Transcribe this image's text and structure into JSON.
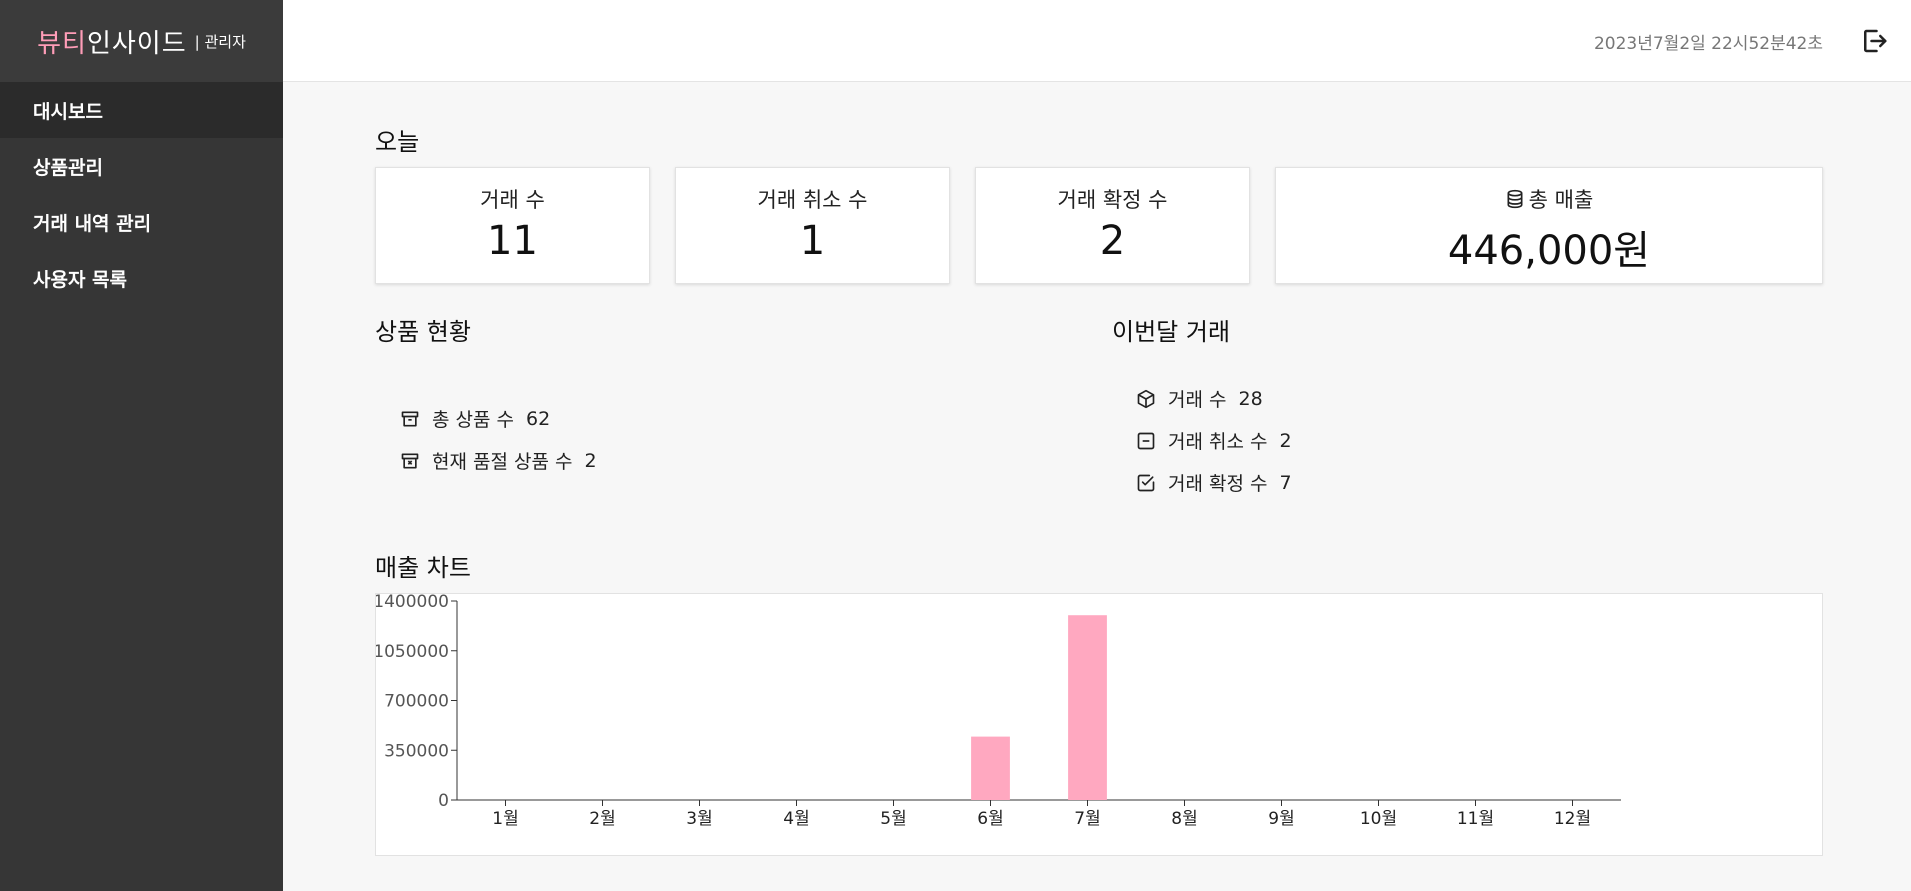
{
  "brand": {
    "logo_part1": "뷰티",
    "logo_part2": "인사이드",
    "role": "| 관리자"
  },
  "sidebar": {
    "items": [
      {
        "label": "대시보드",
        "active": true
      },
      {
        "label": "상품관리",
        "active": false
      },
      {
        "label": "거래 내역 관리",
        "active": false
      },
      {
        "label": "사용자 목록",
        "active": false
      }
    ]
  },
  "header": {
    "datetime": "2023년7월2일 22시52분42초",
    "logout_icon": "logout-icon"
  },
  "today": {
    "title": "오늘",
    "cards": [
      {
        "label": "거래 수",
        "value": "11"
      },
      {
        "label": "거래 취소 수",
        "value": "1"
      },
      {
        "label": "거래 확정 수",
        "value": "2"
      },
      {
        "label": "총 매출",
        "value": "446,000원",
        "icon": "coins-icon"
      }
    ]
  },
  "product_status": {
    "title": "상품 현황",
    "items": [
      {
        "label": "총 상품 수",
        "value": "62",
        "icon": "archive-icon"
      },
      {
        "label": "현재 품절 상품 수",
        "value": "2",
        "icon": "archive-x-icon"
      }
    ]
  },
  "month_trades": {
    "title": "이번달 거래",
    "items": [
      {
        "label": "거래 수",
        "value": "28",
        "icon": "cube-icon"
      },
      {
        "label": "거래 취소 수",
        "value": "2",
        "icon": "minus-square-icon"
      },
      {
        "label": "거래 확정 수",
        "value": "7",
        "icon": "check-square-icon"
      }
    ]
  },
  "sales_chart": {
    "title": "매출 차트"
  },
  "chart_data": {
    "type": "bar",
    "categories": [
      "1월",
      "2월",
      "3월",
      "4월",
      "5월",
      "6월",
      "7월",
      "8월",
      "9월",
      "10월",
      "11월",
      "12월"
    ],
    "values": [
      0,
      0,
      0,
      0,
      0,
      446000,
      1300000,
      0,
      0,
      0,
      0,
      0
    ],
    "yticks": [
      0,
      350000,
      700000,
      1050000,
      1400000
    ],
    "ylim": [
      0,
      1400000
    ],
    "bar_color": "#ffa8c0"
  },
  "colors": {
    "sidebar": "#363636",
    "accent_pink": "#ff9db8",
    "bar": "#ffa8c0"
  }
}
